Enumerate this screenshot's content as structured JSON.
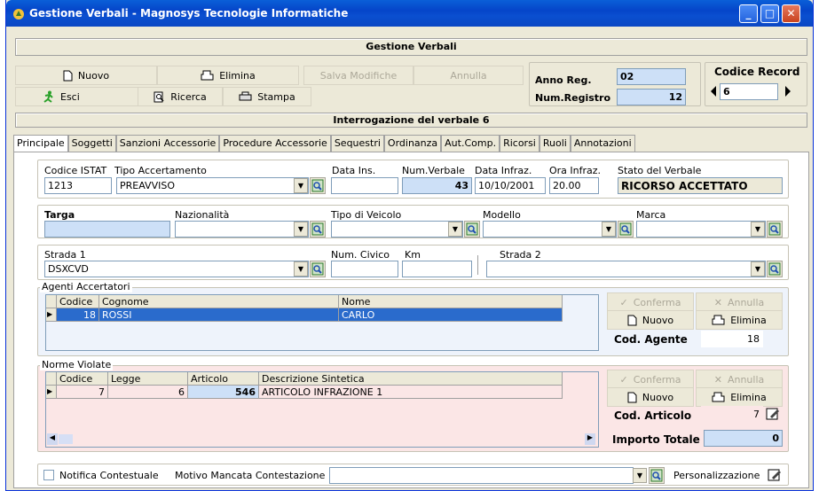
{
  "window": {
    "title": "Gestione Verbali  -  Magnosys Tecnologie Informatiche"
  },
  "header": {
    "title": "Gestione Verbali",
    "subtitle": "Interrogazione del verbale 6"
  },
  "toolbar": {
    "nuovo": "Nuovo",
    "elimina": "Elimina",
    "salva": "Salva Modifiche",
    "annulla": "Annulla",
    "esci": "Esci",
    "ricerca": "Ricerca",
    "stampa": "Stampa"
  },
  "registro": {
    "anno_label": "Anno Reg.",
    "anno_value": "02",
    "num_label": "Num.Registro",
    "num_value": "12",
    "codice_label": "Codice Record",
    "codice_value": "6"
  },
  "tabs": [
    {
      "label": "Principale"
    },
    {
      "label": "Soggetti"
    },
    {
      "label": "Sanzioni Accessorie"
    },
    {
      "label": "Procedure Accessorie"
    },
    {
      "label": "Sequestri"
    },
    {
      "label": "Ordinanza"
    },
    {
      "label": "Aut.Comp."
    },
    {
      "label": "Ricorsi"
    },
    {
      "label": "Ruoli"
    },
    {
      "label": "Annotazioni"
    }
  ],
  "verbale": {
    "codice_istat_label": "Codice ISTAT",
    "codice_istat": "1213",
    "tipo_acc_label": "Tipo Accertamento",
    "tipo_acc": "PREAVVISO",
    "data_ins_label": "Data Ins.",
    "data_ins": "",
    "num_verbale_label": "Num.Verbale",
    "num_verbale": "43",
    "data_infraz_label": "Data Infraz.",
    "data_infraz": "10/10/2001",
    "ora_infraz_label": "Ora Infraz.",
    "ora_infraz": "20.00",
    "stato_label": "Stato del Verbale",
    "stato": "RICORSO ACCETTATO"
  },
  "veicolo": {
    "targa_label": "Targa",
    "nazionalita_label": "Nazionalità",
    "tipo_label": "Tipo di Veicolo",
    "modello_label": "Modello",
    "marca_label": "Marca"
  },
  "strada": {
    "strada1_label": "Strada 1",
    "strada1": "DSXCVD",
    "civico_label": "Num. Civico",
    "km_label": "Km",
    "strada2_label": "Strada 2"
  },
  "agenti": {
    "group_label": "Agenti Accertatori",
    "cols": [
      "Codice",
      "Cognome",
      "Nome"
    ],
    "rows": [
      {
        "codice": "18",
        "cognome": "ROSSI",
        "nome": "CARLO"
      }
    ],
    "conferma": "Conferma",
    "annulla": "Annulla",
    "nuovo": "Nuovo",
    "elimina": "Elimina",
    "cod_label": "Cod. Agente",
    "cod_value": "18"
  },
  "norme": {
    "group_label": "Norme Violate",
    "cols": [
      "Codice",
      "Legge",
      "Articolo",
      "Descrizione Sintetica"
    ],
    "rows": [
      {
        "codice": "7",
        "legge": "6",
        "articolo": "546",
        "descrizione": "ARTICOLO INFRAZIONE 1"
      }
    ],
    "conferma": "Conferma",
    "annulla": "Annulla",
    "nuovo": "Nuovo",
    "elimina": "Elimina",
    "cod_label": "Cod. Articolo",
    "cod_value": "7",
    "importo_label": "Importo Totale",
    "importo_value": "0"
  },
  "footer": {
    "notifica_label": "Notifica Contestuale",
    "motivo_label": "Motivo Mancata Contestazione",
    "personalizzazione_label": "Personalizzazione"
  },
  "colors": {
    "title_blue": "#0a4fd0",
    "field_blue": "#cde0f7",
    "row_selected": "#2a6bcc",
    "pink_area": "#fbe6e6"
  }
}
